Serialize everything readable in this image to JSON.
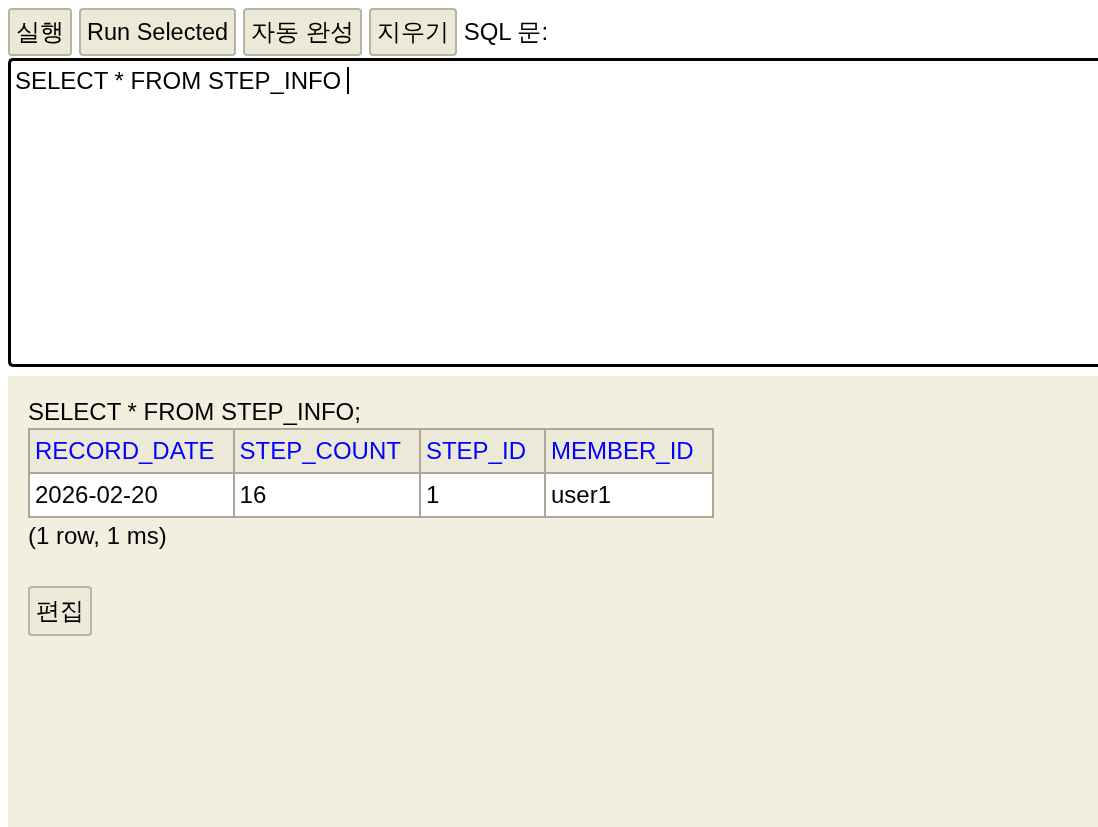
{
  "toolbar": {
    "buttons": [
      "실행",
      "Run Selected",
      "자동 완성",
      "지우기"
    ],
    "label": "SQL 문:"
  },
  "editor": {
    "value": "SELECT * FROM STEP_INFO",
    "focused": true
  },
  "result": {
    "statement": "SELECT * FROM STEP_INFO;",
    "table": {
      "columns": [
        "RECORD_DATE",
        "STEP_COUNT",
        "STEP_ID",
        "MEMBER_ID"
      ],
      "rows": [
        [
          "2026-02-20",
          "16",
          "1",
          "user1"
        ]
      ]
    },
    "summary": "(1 row, 1 ms)",
    "edit_button": "편집"
  }
}
